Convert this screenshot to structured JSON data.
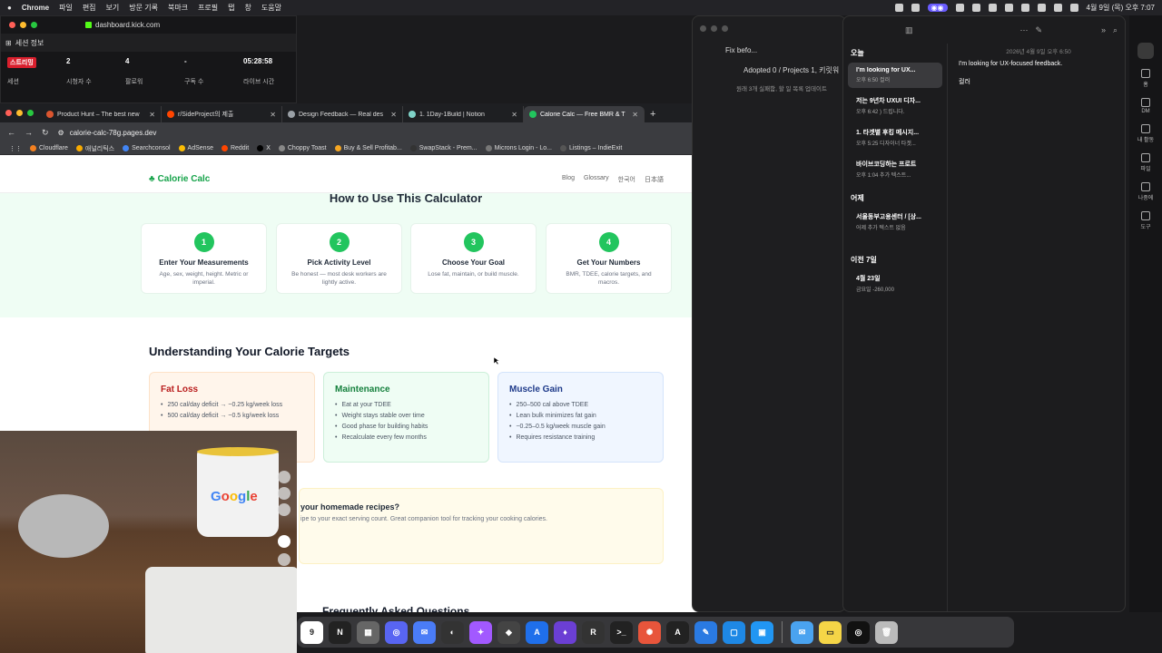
{
  "menubar": {
    "app": "Chrome",
    "items": [
      "파일",
      "편집",
      "보기",
      "방문 기록",
      "북마크",
      "프로필",
      "탭",
      "창",
      "도움말"
    ],
    "clock": "4월 9일 (목) 오후 7:07"
  },
  "stream": {
    "url": "dashboard.kick.com",
    "section_title": "세션 정보",
    "stats": [
      {
        "value": "",
        "badge": "스트리밍",
        "label": "세션"
      },
      {
        "value": "2",
        "label": "시청자 수"
      },
      {
        "value": "4",
        "label": "팔로워"
      },
      {
        "value": "-",
        "label": "구독 수"
      },
      {
        "value": "05:28:58",
        "label": "라이브 시간"
      }
    ]
  },
  "browser": {
    "tabs": [
      {
        "title": "Product Hunt – The best new",
        "color": "#da552f"
      },
      {
        "title": "r/SideProject의 제출",
        "color": "#ff4500"
      },
      {
        "title": "Design Feedback — Real des",
        "color": "#9aa0a6"
      },
      {
        "title": "1. 1Day-1Build | Notion",
        "color": "#7fd3c8"
      },
      {
        "title": "Calorie Calc — Free BMR & T",
        "color": "#22c55e",
        "active": true
      }
    ],
    "url": "calorie-calc-78g.pages.dev",
    "bookmarks": [
      {
        "label": "Cloudflare",
        "color": "#f38020"
      },
      {
        "label": "애널리틱스",
        "color": "#f9ab00"
      },
      {
        "label": "Searchconsol",
        "color": "#4285f4"
      },
      {
        "label": "AdSense",
        "color": "#fbbc04"
      },
      {
        "label": "Reddit",
        "color": "#ff4500"
      },
      {
        "label": "X",
        "color": "#000000"
      },
      {
        "label": "Choppy Toast",
        "color": "#888888"
      },
      {
        "label": "Buy & Sell Profitab...",
        "color": "#f5a623"
      },
      {
        "label": "SwapStack - Prem...",
        "color": "#333333"
      },
      {
        "label": "Microns Login - Lo...",
        "color": "#777777"
      },
      {
        "label": "Listings – IndieExit",
        "color": "#555555"
      }
    ]
  },
  "site": {
    "logo": "Calorie Calc",
    "nav": [
      "Blog",
      "Glossary",
      "한국어",
      "日本語"
    ],
    "how_title": "How to Use This Calculator",
    "steps": [
      {
        "num": "1",
        "title": "Enter Your Measurements",
        "desc": "Age, sex, weight, height. Metric or imperial."
      },
      {
        "num": "2",
        "title": "Pick Activity Level",
        "desc": "Be honest — most desk workers are lightly active."
      },
      {
        "num": "3",
        "title": "Choose Your Goal",
        "desc": "Lose fat, maintain, or build muscle."
      },
      {
        "num": "4",
        "title": "Get Your Numbers",
        "desc": "BMR, TDEE, calorie targets, and macros."
      }
    ],
    "understand_title": "Understanding Your Calorie Targets",
    "cards": [
      {
        "title": "Fat Loss",
        "color": "#b91c1c",
        "bg": "#fff5eb",
        "border": "#fde2c8",
        "items": [
          "250 cal/day deficit → ~0.25 kg/week loss",
          "500 cal/day deficit → ~0.5 kg/week loss"
        ]
      },
      {
        "title": "Maintenance",
        "color": "#15803d",
        "bg": "#effdf4",
        "border": "#ccefd9",
        "items": [
          "Eat at your TDEE",
          "Weight stays stable over time",
          "Good phase for building habits",
          "Recalculate every few months"
        ]
      },
      {
        "title": "Muscle Gain",
        "color": "#1e3a8a",
        "bg": "#f0f6ff",
        "border": "#d4e4fb",
        "items": [
          "250–500 cal above TDEE",
          "Lean bulk minimizes fat gain",
          "~0.25–0.5 kg/week muscle gain",
          "Requires resistance training"
        ]
      }
    ],
    "recipes_q": "your homemade recipes?",
    "recipes_s": "ipe to your exact serving count. Great companion tool for tracking your cooking calories.",
    "faq_title": "Frequently Asked Questions"
  },
  "midwin": {
    "title": "Fix befo...",
    "line1": "Adopted 0 / Projects 1, 키릿워",
    "line2": "원래 3개 실패함, 할 일 목록 업데이트"
  },
  "notes": {
    "today": "오늘",
    "yesterday": "어제",
    "prev7": "이전 7일",
    "items": [
      {
        "title": "I'm looking for UX...",
        "date": "오후 6:50  컬러",
        "selected": true
      },
      {
        "title": "저는 9년차 UXUI 디자...",
        "date": "오후 6:42  ) 드립니다."
      },
      {
        "title": "1. 타겟별 후킹 메시지...",
        "date": "오후 5:25  디자이너 타겟..."
      },
      {
        "title": "바이브코딩하는 프로트",
        "date": "오후 1:04  추가 텍스트..."
      }
    ],
    "yesterday_items": [
      {
        "title": "서울동부고용센터 / [상...",
        "date": "어제  추가 텍스트 없음"
      }
    ],
    "prev_items": [
      {
        "title": "4월 23일",
        "date": "금요일  -260,000"
      }
    ],
    "editor_date": "2026년 4월 9일 오후 6:50",
    "editor_body": "I'm looking for UX-focused feedback.",
    "editor_body2": "컬러"
  },
  "rightbar": [
    "홈",
    "DM",
    "내 활동",
    "파일",
    "나중에",
    "도구"
  ],
  "dock": [
    "9",
    "N",
    "▦",
    "◎",
    "✉",
    "◐",
    "✦",
    "◆",
    "A",
    "♦",
    "R",
    ">_",
    "✺",
    "A",
    "✎",
    "▢",
    "▣",
    "✉",
    "▭",
    "◎"
  ]
}
